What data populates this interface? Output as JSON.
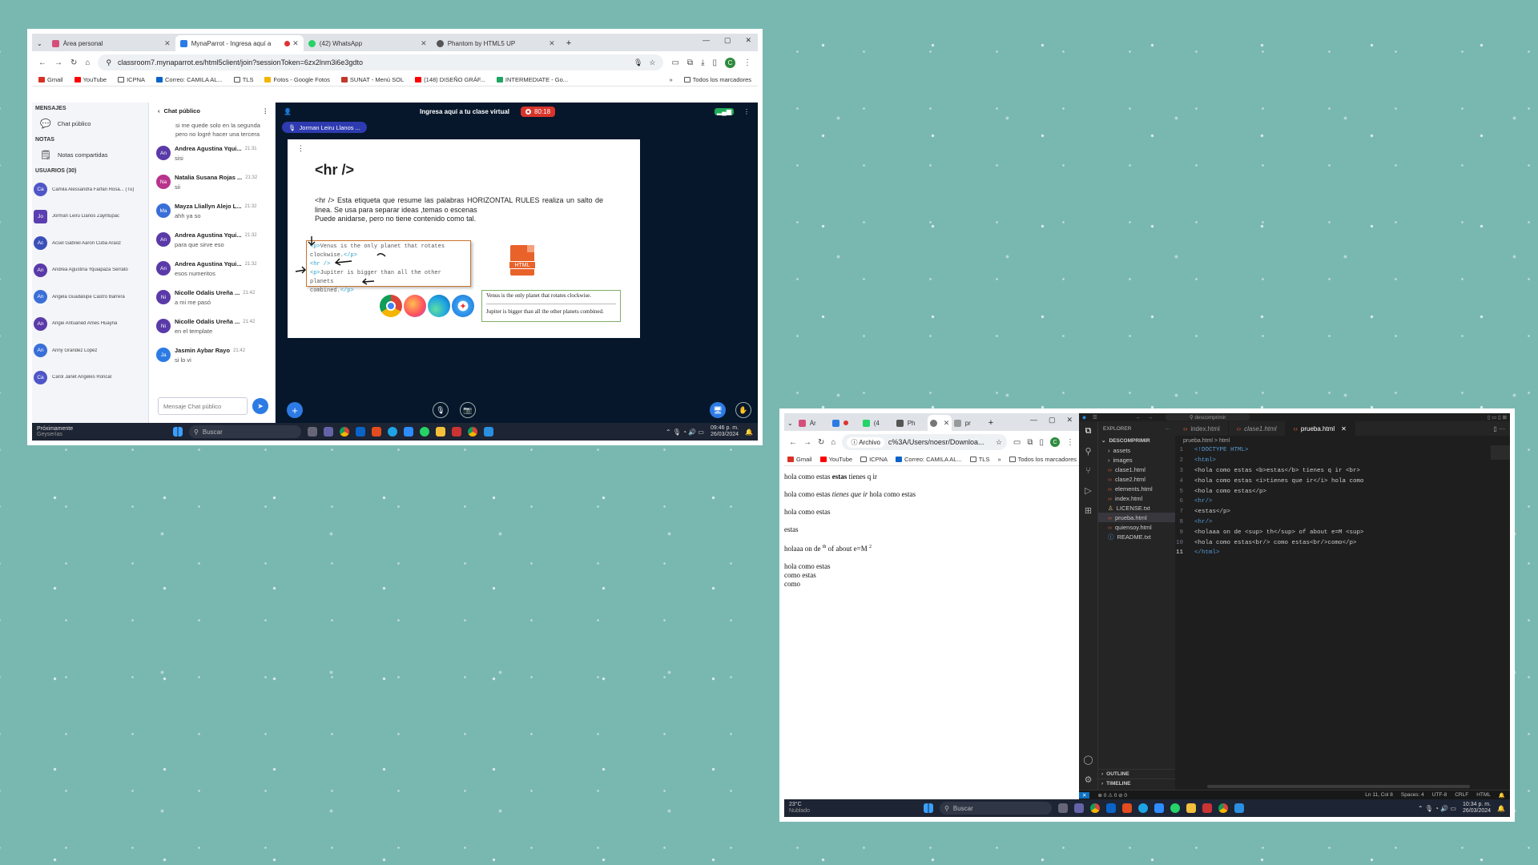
{
  "shot1": {
    "tabs": [
      {
        "label": "Área personal",
        "color": "#d4507a"
      },
      {
        "label": "MynaParrot - Ingresa aquí a",
        "color": "#2c7be5"
      },
      {
        "label": "(42) WhatsApp",
        "color": "#25d366"
      },
      {
        "label": "Phantom by HTML5 UP",
        "color": "#555555"
      }
    ],
    "new_tab": "+",
    "url": "classroom7.mynaparrot.es/html5client/join?sessionToken=6zx2lnm3i6e3gdto",
    "bookmarks": [
      "Gmail",
      "YouTube",
      "ICPNA",
      "Correo: CAMILA AL...",
      "TLS",
      "Fotos - Google Fotos",
      "SUNAT - Menú SOL",
      "(148) DISEÑO GRÁF...",
      "INTERMEDIATE - Go..."
    ],
    "all_bookmarks": "Todos los marcadores",
    "sidebar": {
      "messages_heading": "MENSAJES",
      "public_chat": "Chat público",
      "notes_heading": "NOTAS",
      "shared_notes": "Notas compartidas",
      "users_heading": "USUARIOS (30)",
      "users": [
        {
          "initials": "Ca",
          "name": "Camila Alessandra Farfan Rosa... (Tú)",
          "color": "#4f56c7"
        },
        {
          "initials": "Jo",
          "name": "Jorman Leiru Llanos Zayritupac",
          "color": "#5b3fb0"
        },
        {
          "initials": "Ac",
          "name": "Acsel Gabriel Aaron Cuba Araoz",
          "color": "#3a4fb8"
        },
        {
          "initials": "An",
          "name": "Andrea Agustina Yquiapaza Serrato",
          "color": "#5a3aa8"
        },
        {
          "initials": "An",
          "name": "Angela Guadalupe Castro Barrera",
          "color": "#3a6fd8"
        },
        {
          "initials": "An",
          "name": "Angie Antuaned Ames Huayna",
          "color": "#5a3aa8"
        },
        {
          "initials": "An",
          "name": "Anny Grandez Lopez",
          "color": "#3a6fd8"
        },
        {
          "initials": "Ca",
          "name": "Carol Janet Angeles Roncal",
          "color": "#4f56c7"
        }
      ]
    },
    "chat": {
      "title": "Chat público",
      "top_text": "si me quede solo en la segunda pero no logré hacer una tercera",
      "messages": [
        {
          "initials": "An",
          "name": "Andrea Agustina Yqui...",
          "time": "21:31",
          "text": "sisi",
          "color": "#5a3aa8"
        },
        {
          "initials": "Na",
          "name": "Natalia Susana Rojas ...",
          "time": "21:32",
          "text": "sii",
          "color": "#b8348c"
        },
        {
          "initials": "Ma",
          "name": "Mayza Lliallyn Alejo L...",
          "time": "21:32",
          "text": "ahh ya so",
          "color": "#3a6fd8"
        },
        {
          "initials": "An",
          "name": "Andrea Agustina Yqui...",
          "time": "21:32",
          "text": "para que sirve eso",
          "color": "#5a3aa8"
        },
        {
          "initials": "An",
          "name": "Andrea Agustina Yqui...",
          "time": "21:32",
          "text": "esos numeritos",
          "color": "#5a3aa8"
        },
        {
          "initials": "Ni",
          "name": "Nicolle Odalis Ureña ...",
          "time": "21:42",
          "text": "a mi me pasó",
          "color": "#5a3aa8"
        },
        {
          "initials": "Ni",
          "name": "Nicolle Odalis Ureña ...",
          "time": "21:42",
          "text": "en el template",
          "color": "#5a3aa8"
        },
        {
          "initials": "Ja",
          "name": "Jasmin Aybar Rayo",
          "time": "21:42",
          "text": "si lo vi",
          "color": "#2c7be5"
        }
      ],
      "placeholder": "Mensaje Chat público"
    },
    "presentation": {
      "header_title": "Ingresa aquí a tu clase virtual",
      "rec_time": "80:18",
      "presenter": "Jorman Leiru Llanos ...",
      "slide_title": "<hr />",
      "slide_body": "<hr /> Esta etiqueta que resume las palabras HORIZONTAL RULES realiza un salto de linea. Se usa para separar ideas ,temas o escenas",
      "slide_body2": "Puede anidarse, pero no tiene contenido como tal.",
      "code_lines": [
        {
          "open": "<p>",
          "text": "Venus is the only planet that rotates",
          "close": ""
        },
        {
          "open": "",
          "text": "   clockwise.",
          "close": "</p>"
        },
        {
          "open": "<hr />",
          "text": "",
          "close": ""
        },
        {
          "open": "<p>",
          "text": "Jupiter is bigger than all the other planets",
          "close": ""
        },
        {
          "open": "",
          "text": "   combined.",
          "close": "</p>"
        }
      ],
      "html_badge": "HTML",
      "result_line1": "Venus is the only planet that rotates clockwise.",
      "result_line2": "Jupiter is bigger than all the other planets combined."
    },
    "taskbar": {
      "notification": "Próximamente",
      "notification_sub": "Geyserías",
      "search": "Buscar",
      "time": "09:46 p. m.",
      "date": "26/03/2024"
    }
  },
  "shot2": {
    "tabs": [
      "Ár",
      "(4",
      "Ph",
      "pr"
    ],
    "archivo": "Archivo",
    "url": "c%3A/Users/noesr/Downloa...",
    "bookmarks": [
      "Gmail",
      "YouTube",
      "ICPNA",
      "Correo: CAMILA AL...",
      "TLS"
    ],
    "all_bookmarks": "Todos los marcadores",
    "page": {
      "line1_a": "hola como estas ",
      "line1_b": "estas",
      "line1_c": " tienes q ir",
      "line2_a": "hola como estas ",
      "line2_b": "tienes que ir",
      "line2_c": " hola como estas",
      "line3": "hola como estas",
      "line4": "estas",
      "line5_a": "holaaa on de ",
      "line5_sup": "th",
      "line5_b": " of about e=M ",
      "line5_sup2": "2",
      "line6": "hola como estas",
      "line7": "como estas",
      "line8": "como"
    },
    "vscode": {
      "search": "descomprimir",
      "explorer_title": "EXPLORER",
      "folder": "DESCOMPRIMIR",
      "files": [
        "assets",
        "images",
        "clase1.html",
        "clase2.html",
        "elements.html",
        "index.html",
        "LICENSE.txt",
        "prueba.html",
        "quiensoy.html",
        "README.txt"
      ],
      "editor_tabs": [
        "index.html",
        "clase1.html",
        "prueba.html"
      ],
      "breadcrumb": "prueba.html > html",
      "code": [
        "<!DOCTYPE HTML>",
        "<html>",
        "<hola como estas <b>estas</b> tienes q ir <br>",
        "<hola como estas <i>tienes que ir</i> hola como",
        "<hola como estas</p>",
        "<hr/>",
        "<estas</p>",
        "<hr/>",
        "<holaaa on de <sup> th</sup> of about e=M <sup>",
        "<hola como estas<br/> como estas<br/>como</p>",
        "</html>"
      ],
      "outline": "OUTLINE",
      "timeline": "TIMELINE",
      "status_left": "⊗ 0 ⚠ 0   ⊘ 0",
      "status_right": [
        "Ln 11, Col 8",
        "Spaces: 4",
        "UTF-8",
        "CRLF",
        "HTML"
      ]
    },
    "taskbar": {
      "weather": "23°C",
      "weather_sub": "Nublado",
      "search": "Buscar",
      "time": "10:34 p. m.",
      "date": "26/03/2024"
    }
  }
}
